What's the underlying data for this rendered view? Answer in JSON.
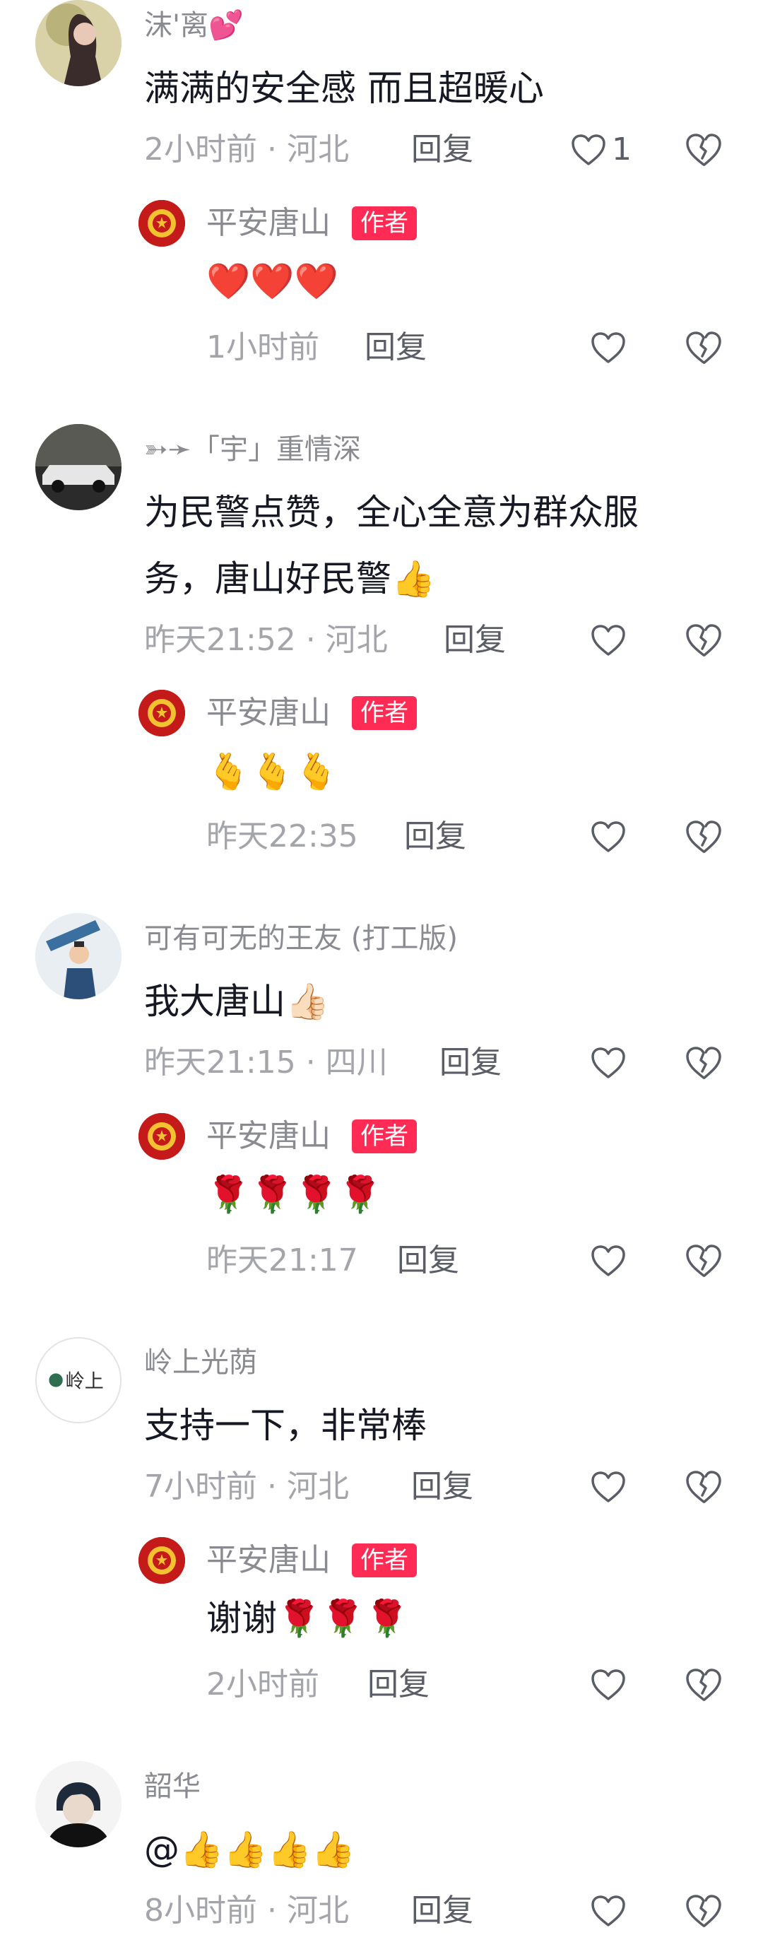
{
  "comments": [
    {
      "username": "沫'离💕",
      "text": "满满的安全感 而且超暖心",
      "meta": "2小时前 · 河北",
      "reply_label": "回复",
      "like_count": "1",
      "reply": {
        "name": "平安唐山",
        "badge": "作者",
        "text": "❤️❤️❤️",
        "meta": "1小时前",
        "reply_label": "回复"
      }
    },
    {
      "username": "➳➛「宇」重情深",
      "text_line1": "为民警点赞，全心全意为群众服",
      "text_line2": "务，唐山好民警👍",
      "meta": "昨天21:52 · 河北",
      "reply_label": "回复",
      "reply": {
        "name": "平安唐山",
        "badge": "作者",
        "text": "🫰🫰🫰",
        "meta": "昨天22:35",
        "reply_label": "回复"
      }
    },
    {
      "username": "可有可无的王友 (打工版)",
      "text": "我大唐山👍🏻",
      "meta": "昨天21:15 · 四川",
      "reply_label": "回复",
      "reply": {
        "name": "平安唐山",
        "badge": "作者",
        "text": "🌹🌹🌹🌹",
        "meta": "昨天21:17",
        "reply_label": "回复"
      }
    },
    {
      "username": "岭上光荫",
      "avatar_text": "岭上",
      "text": "支持一下，非常棒",
      "meta": "7小时前 · 河北",
      "reply_label": "回复",
      "reply": {
        "name": "平安唐山",
        "badge": "作者",
        "text": "谢谢🌹🌹🌹",
        "meta": "2小时前",
        "reply_label": "回复"
      }
    },
    {
      "username": "韶华",
      "text": "@👍👍👍👍",
      "meta": "8小时前 · 河北",
      "reply_label": "回复"
    }
  ],
  "colors": {
    "accent": "#fe2c55",
    "muted": "#a4a5aa",
    "text": "#161823"
  },
  "icons": {
    "like": "heart-outline-icon",
    "dislike": "broken-heart-icon"
  }
}
